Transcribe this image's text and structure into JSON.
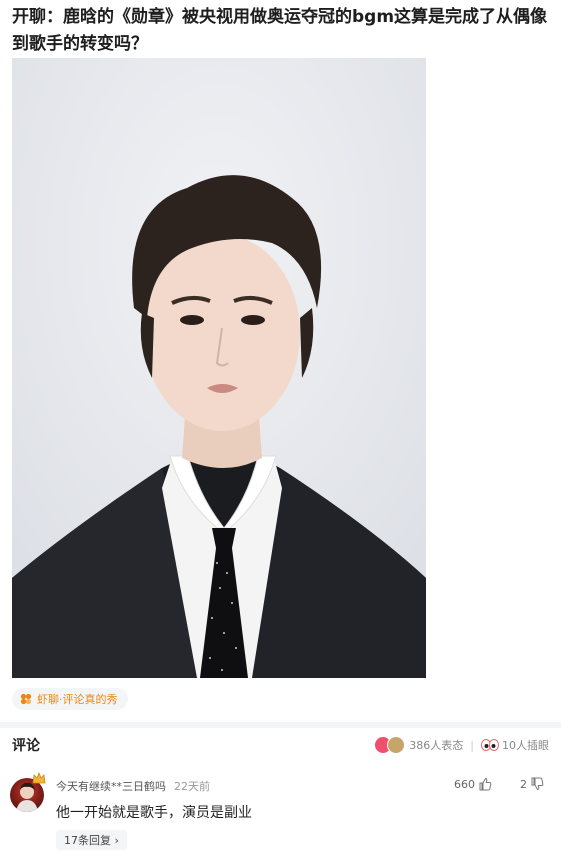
{
  "post": {
    "title": "开聊：鹿晗的《勋章》被央视用做奥运夺冠的bgm这算是完成了从偶像到歌手的转变吗？"
  },
  "tag": {
    "label": "虾聊·评论真的秀",
    "icon": "shrimp-chat-icon",
    "color": "#f0860f"
  },
  "comments_section": {
    "title": "评论",
    "reactions_text": "386人表态",
    "plugs_text": "10人插眼"
  },
  "comments": [
    {
      "username": "今天有继续**三日鹤吗",
      "time": "22天前",
      "text": "他一开始就是歌手，演员是副业",
      "likes": "660",
      "dislikes": "2",
      "replies_label": "17条回复 ›"
    }
  ]
}
